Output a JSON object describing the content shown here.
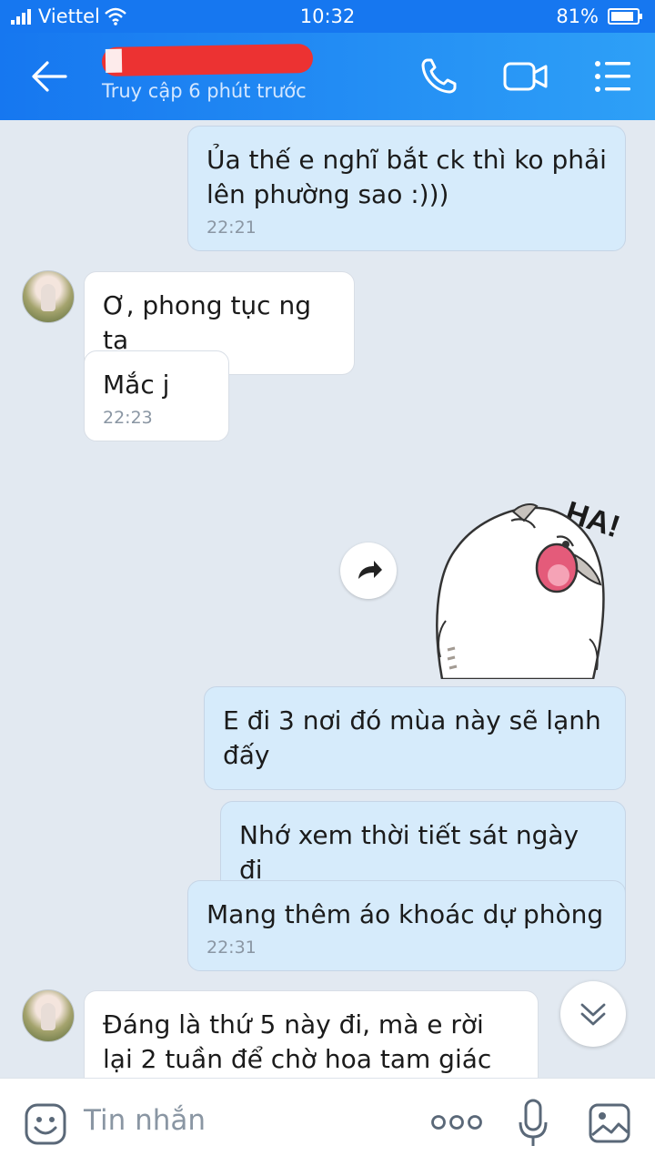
{
  "status_bar": {
    "carrier": "Viettel",
    "time": "10:32",
    "battery": "81%"
  },
  "header": {
    "last_seen": "Truy cập 6 phút trước"
  },
  "messages": [
    {
      "direction": "out",
      "text": "Ủa thế e nghĩ bắt ck thì ko phải lên phường sao :)))",
      "time": "22:21"
    },
    {
      "direction": "in",
      "text": "Ơ, phong tục ng ta",
      "time": ""
    },
    {
      "direction": "in",
      "text": "Mắc j",
      "time": "22:23"
    },
    {
      "direction": "in",
      "type": "sticker",
      "sticker_text": "HA!"
    },
    {
      "direction": "out",
      "text": "E đi 3 nơi đó mùa này sẽ lạnh đấy",
      "time": ""
    },
    {
      "direction": "out",
      "text": "Nhớ xem thời tiết sát ngày đi",
      "time": ""
    },
    {
      "direction": "out",
      "text": "Mang thêm áo khoác dự phòng",
      "time": "22:31"
    },
    {
      "direction": "in",
      "text": "Đáng là thứ 5 này đi, mà e rời lại 2 tuần để chờ hoa tam giác",
      "time": ""
    }
  ],
  "composer": {
    "placeholder": "Tin nhắn"
  },
  "colors": {
    "header_start": "#1677f0",
    "header_end": "#2ea0f7",
    "outgoing_bubble": "#d6ebfb",
    "incoming_bubble": "#ffffff",
    "chat_background": "#e2e9f1"
  },
  "icons": {
    "back": "arrow-left-icon",
    "call": "phone-icon",
    "video": "video-camera-icon",
    "menu": "list-menu-icon",
    "forward": "share-forward-icon",
    "scroll": "double-chevron-down-icon",
    "emoji": "emoji-icon",
    "more": "more-dots-icon",
    "mic": "microphone-icon",
    "image": "image-gallery-icon"
  }
}
